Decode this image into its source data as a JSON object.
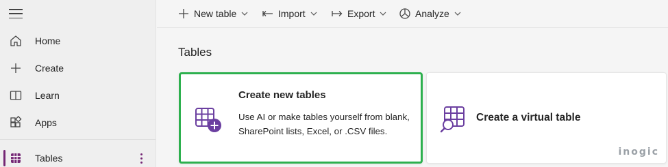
{
  "sidebar": {
    "items": [
      {
        "label": "Home",
        "icon": "home-icon"
      },
      {
        "label": "Create",
        "icon": "plus-icon"
      },
      {
        "label": "Learn",
        "icon": "book-icon"
      },
      {
        "label": "Apps",
        "icon": "apps-icon"
      },
      {
        "label": "Tables",
        "icon": "table-grid-icon",
        "active": true
      }
    ]
  },
  "toolbar": {
    "new_table": "New table",
    "import": "Import",
    "export": "Export",
    "analyze": "Analyze"
  },
  "main": {
    "title": "Tables",
    "cards": [
      {
        "title": "Create new tables",
        "description": "Use AI or make tables yourself from blank, SharePoint lists, Excel, or .CSV files.",
        "icon": "table-add-icon"
      },
      {
        "title": "Create a virtual table",
        "icon": "table-search-icon"
      }
    ]
  },
  "watermark": "inogic",
  "colors": {
    "accent": "#742774",
    "highlight_border": "#2db04e",
    "icon_purple": "#6b3fa0"
  }
}
